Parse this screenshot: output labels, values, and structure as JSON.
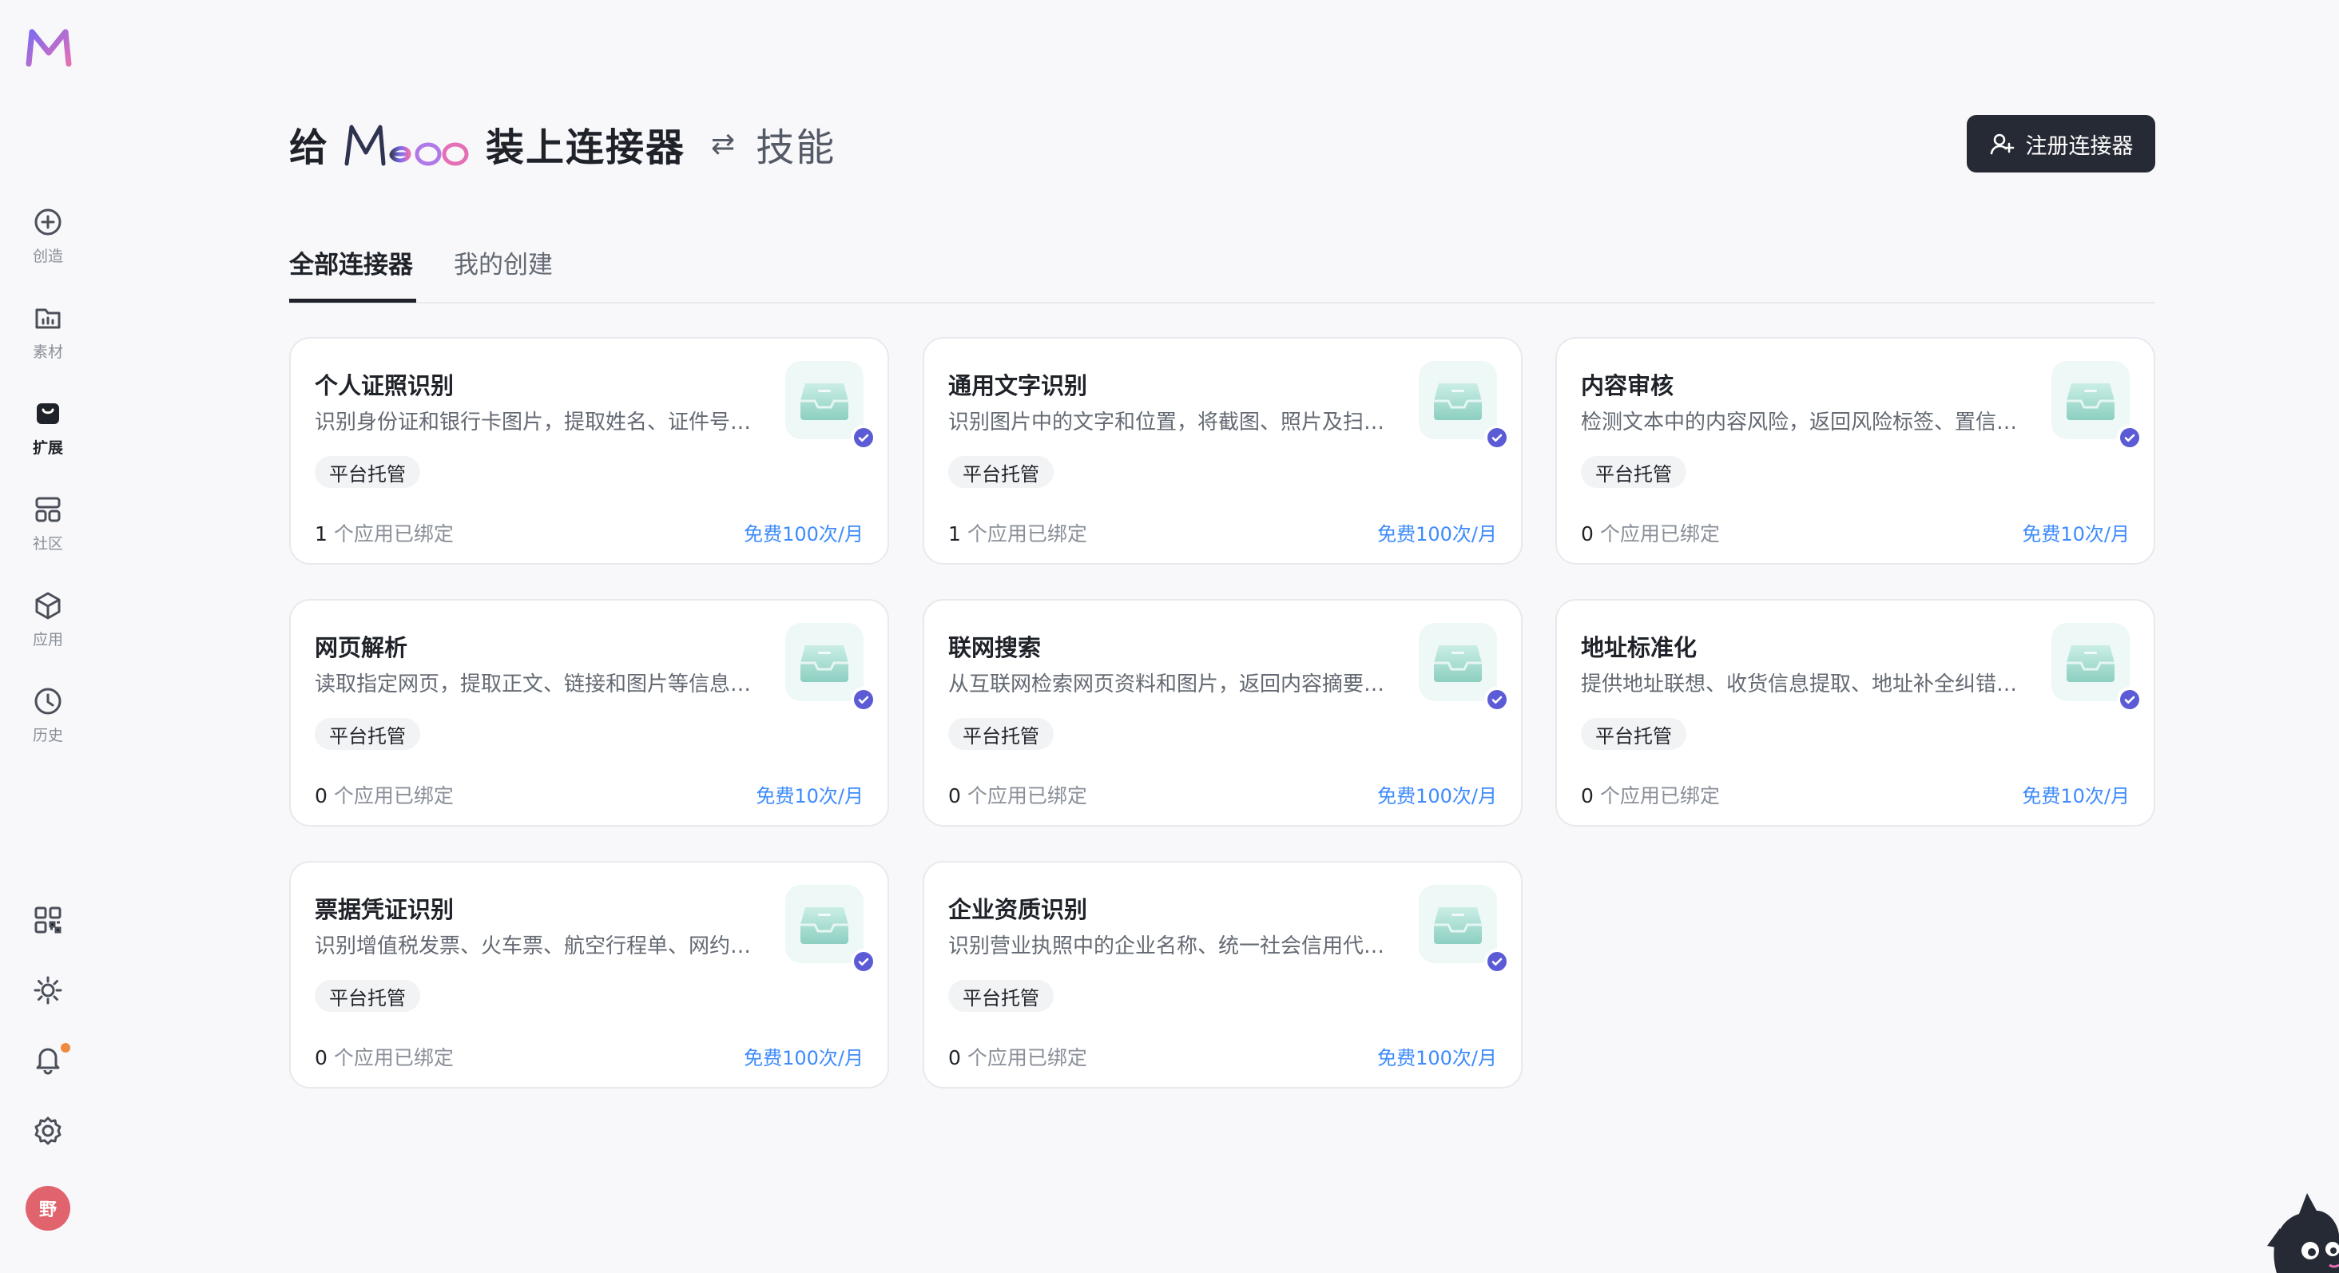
{
  "sidebar": {
    "nav": [
      {
        "label": "创造",
        "icon": "plus-circle-icon"
      },
      {
        "label": "素材",
        "icon": "folder-image-icon"
      },
      {
        "label": "扩展",
        "icon": "bag-icon",
        "active": true
      },
      {
        "label": "社区",
        "icon": "grid-icon"
      },
      {
        "label": "应用",
        "icon": "cube-icon"
      },
      {
        "label": "历史",
        "icon": "clock-icon"
      }
    ],
    "utilities": [
      "qr-code-icon",
      "sun-icon",
      "bell-icon",
      "gear-icon"
    ],
    "avatar_text": "野"
  },
  "header": {
    "prefix": "给",
    "brand": "Meoo",
    "suffix": "装上连接器",
    "swap_symbol": "⇄",
    "skill": "技能",
    "register_label": "注册连接器"
  },
  "tabs": [
    {
      "label": "全部连接器",
      "active": true
    },
    {
      "label": "我的创建",
      "active": false
    }
  ],
  "bound_suffix": "个应用已绑定",
  "cards": [
    {
      "title": "个人证照识别",
      "desc": "识别身份证和银行卡图片，提取姓名、证件号…",
      "tag": "平台托管",
      "bound": "1",
      "quota": "免费100次/月"
    },
    {
      "title": "通用文字识别",
      "desc": "识别图片中的文字和位置，将截图、照片及扫…",
      "tag": "平台托管",
      "bound": "1",
      "quota": "免费100次/月"
    },
    {
      "title": "内容审核",
      "desc": "检测文本中的内容风险，返回风险标签、置信…",
      "tag": "平台托管",
      "bound": "0",
      "quota": "免费10次/月"
    },
    {
      "title": "网页解析",
      "desc": "读取指定网页，提取正文、链接和图片等信息…",
      "tag": "平台托管",
      "bound": "0",
      "quota": "免费10次/月"
    },
    {
      "title": "联网搜索",
      "desc": "从互联网检索网页资料和图片，返回内容摘要…",
      "tag": "平台托管",
      "bound": "0",
      "quota": "免费100次/月"
    },
    {
      "title": "地址标准化",
      "desc": "提供地址联想、收货信息提取、地址补全纠错…",
      "tag": "平台托管",
      "bound": "0",
      "quota": "免费10次/月"
    },
    {
      "title": "票据凭证识别",
      "desc": "识别增值税发票、火车票、航空行程单、网约…",
      "tag": "平台托管",
      "bound": "0",
      "quota": "免费100次/月"
    },
    {
      "title": "企业资质识别",
      "desc": "识别营业执照中的企业名称、统一社会信用代…",
      "tag": "平台托管",
      "bound": "0",
      "quota": "免费100次/月"
    }
  ],
  "colors": {
    "accent_blue": "#3d8bfd",
    "dark_button": "#262a35",
    "verified_purple": "#5b5bd6",
    "icon_teal": "#a9dcd2"
  }
}
